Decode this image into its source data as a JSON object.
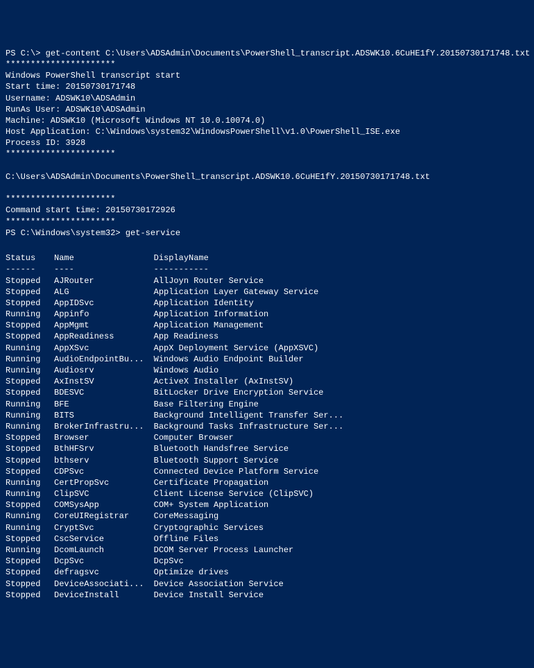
{
  "prompt1": {
    "path": "PS C:\\>",
    "command": "get-content C:\\Users\\ADSAdmin\\Documents\\PowerShell_transcript.ADSWK10.6CuHE1fY.20150730171748.txt"
  },
  "sep": "**********************",
  "transcript_header": {
    "title": "Windows PowerShell transcript start",
    "start_time": "Start time: 20150730171748",
    "username": "Username: ADSWK10\\ADSAdmin",
    "runas": "RunAs User: ADSWK10\\ADSAdmin",
    "machine": "Machine: ADSWK10 (Microsoft Windows NT 10.0.10074.0)",
    "host_app": "Host Application: C:\\Windows\\system32\\WindowsPowerShell\\v1.0\\PowerShell_ISE.exe",
    "process_id": "Process ID: 3928"
  },
  "transcript_path": "C:\\Users\\ADSAdmin\\Documents\\PowerShell_transcript.ADSWK10.6CuHE1fY.20150730171748.txt",
  "command_start": "Command start time: 20150730172926",
  "prompt2": {
    "path": "PS C:\\Windows\\system32>",
    "command": "get-service"
  },
  "table": {
    "headers": {
      "status": "Status",
      "name": "Name",
      "display": "DisplayName"
    },
    "dashes": {
      "status": "------",
      "name": "----",
      "display": "-----------"
    },
    "rows": [
      {
        "status": "Stopped",
        "name": "AJRouter",
        "display": "AllJoyn Router Service"
      },
      {
        "status": "Stopped",
        "name": "ALG",
        "display": "Application Layer Gateway Service"
      },
      {
        "status": "Stopped",
        "name": "AppIDSvc",
        "display": "Application Identity"
      },
      {
        "status": "Running",
        "name": "Appinfo",
        "display": "Application Information"
      },
      {
        "status": "Stopped",
        "name": "AppMgmt",
        "display": "Application Management"
      },
      {
        "status": "Stopped",
        "name": "AppReadiness",
        "display": "App Readiness"
      },
      {
        "status": "Running",
        "name": "AppXSvc",
        "display": "AppX Deployment Service (AppXSVC)"
      },
      {
        "status": "Running",
        "name": "AudioEndpointBu...",
        "display": "Windows Audio Endpoint Builder"
      },
      {
        "status": "Running",
        "name": "Audiosrv",
        "display": "Windows Audio"
      },
      {
        "status": "Stopped",
        "name": "AxInstSV",
        "display": "ActiveX Installer (AxInstSV)"
      },
      {
        "status": "Stopped",
        "name": "BDESVC",
        "display": "BitLocker Drive Encryption Service"
      },
      {
        "status": "Running",
        "name": "BFE",
        "display": "Base Filtering Engine"
      },
      {
        "status": "Running",
        "name": "BITS",
        "display": "Background Intelligent Transfer Ser..."
      },
      {
        "status": "Running",
        "name": "BrokerInfrastru...",
        "display": "Background Tasks Infrastructure Ser..."
      },
      {
        "status": "Stopped",
        "name": "Browser",
        "display": "Computer Browser"
      },
      {
        "status": "Stopped",
        "name": "BthHFSrv",
        "display": "Bluetooth Handsfree Service"
      },
      {
        "status": "Stopped",
        "name": "bthserv",
        "display": "Bluetooth Support Service"
      },
      {
        "status": "Stopped",
        "name": "CDPSvc",
        "display": "Connected Device Platform Service"
      },
      {
        "status": "Running",
        "name": "CertPropSvc",
        "display": "Certificate Propagation"
      },
      {
        "status": "Running",
        "name": "ClipSVC",
        "display": "Client License Service (ClipSVC)"
      },
      {
        "status": "Stopped",
        "name": "COMSysApp",
        "display": "COM+ System Application"
      },
      {
        "status": "Running",
        "name": "CoreUIRegistrar",
        "display": "CoreMessaging"
      },
      {
        "status": "Running",
        "name": "CryptSvc",
        "display": "Cryptographic Services"
      },
      {
        "status": "Stopped",
        "name": "CscService",
        "display": "Offline Files"
      },
      {
        "status": "Running",
        "name": "DcomLaunch",
        "display": "DCOM Server Process Launcher"
      },
      {
        "status": "Stopped",
        "name": "DcpSvc",
        "display": "DcpSvc"
      },
      {
        "status": "Stopped",
        "name": "defragsvc",
        "display": "Optimize drives"
      },
      {
        "status": "Stopped",
        "name": "DeviceAssociati...",
        "display": "Device Association Service"
      },
      {
        "status": "Stopped",
        "name": "DeviceInstall",
        "display": "Device Install Service"
      }
    ]
  }
}
